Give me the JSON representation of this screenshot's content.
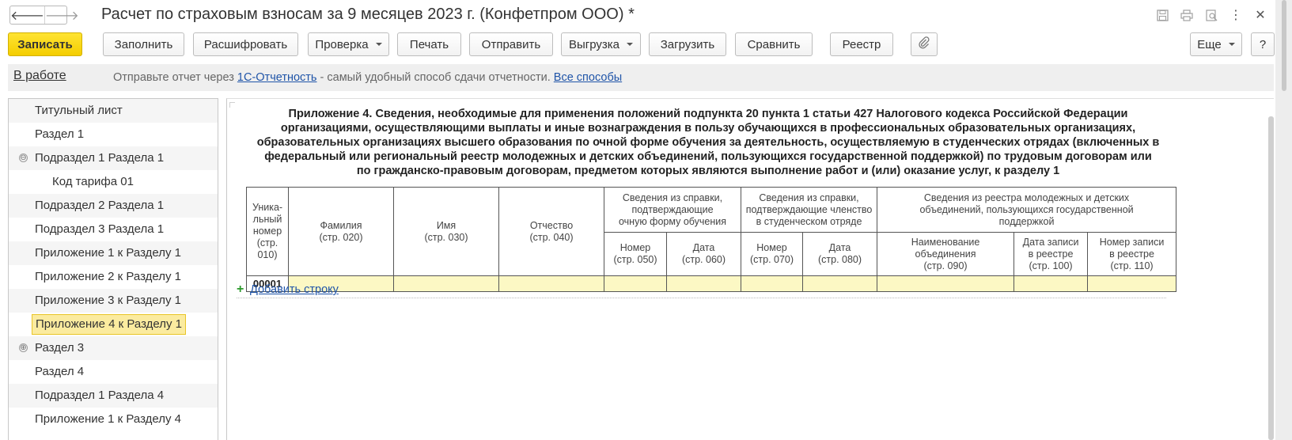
{
  "window": {
    "title": "Расчет по страховым взносам за 9 месяцев 2023 г. (Конфетпром ООО) *",
    "back_icon": "arrow-left-icon",
    "forward_icon": "arrow-right-icon",
    "icons": [
      "save-icon",
      "print-icon",
      "preview-icon",
      "more-vertical-icon",
      "close-icon"
    ]
  },
  "toolbar": {
    "save": "Записать",
    "fill": "Заполнить",
    "decode": "Расшифровать",
    "check": "Проверка",
    "print": "Печать",
    "send": "Отправить",
    "export": "Выгрузка",
    "load": "Загрузить",
    "compare": "Сравнить",
    "registry": "Реестр",
    "attach_icon": "paperclip-icon",
    "more": "Еще",
    "help": "?"
  },
  "infobar": {
    "status": "В работе",
    "text_before": "Отправьте отчет через ",
    "link1": "1С-Отчетность",
    "text_after": " - самый удобный способ сдачи отчетности. ",
    "link2": "Все способы"
  },
  "tree": {
    "items": [
      {
        "label": "Титульный лист"
      },
      {
        "label": "Раздел 1"
      },
      {
        "label": "Подраздел 1 Раздела 1",
        "toggle": "⊖"
      },
      {
        "label": "Код тарифа 01"
      },
      {
        "label": "Подраздел 2 Раздела 1"
      },
      {
        "label": "Подраздел 3 Раздела 1"
      },
      {
        "label": "Приложение 1 к Разделу 1"
      },
      {
        "label": "Приложение 2 к Разделу 1"
      },
      {
        "label": "Приложение 3 к Разделу 1"
      },
      {
        "label": "Приложение 4 к Разделу 1",
        "selected": true
      },
      {
        "label": "Раздел 3",
        "toggle": "⊕"
      },
      {
        "label": "Раздел 4"
      },
      {
        "label": "Подраздел 1 Раздела 4"
      },
      {
        "label": "Приложение 1 к Разделу 4"
      }
    ]
  },
  "form": {
    "heading": [
      "Приложение 4. Сведения, необходимые для применения положений подпункта 20 пункта 1 статьи 427 Налогового кодекса Российской Федерации",
      "организациями, осуществляющими выплаты и иные вознаграждения в пользу обучающихся в профессиональных образовательных организациях,",
      "образовательных организациях высшего образования по очной форме обучения за деятельность, осуществляемую в студенческих отрядах (включенных в",
      "федеральный или региональный реестр молодежных и детских объединений, пользующихся государственной поддержкой) по трудовым договорам или",
      "по гражданско-правовым договорам, предметом которых являются выполнение работ и (или) оказание услуг, к разделу 1"
    ],
    "table": {
      "col_uid": [
        "Уника-",
        "льный",
        "номер",
        "(стр.",
        "010)"
      ],
      "col_surname": [
        "Фамилия",
        "(стр. 020)"
      ],
      "col_name": [
        "Имя",
        "(стр. 030)"
      ],
      "col_patronymic": [
        "Отчество",
        "(стр. 040)"
      ],
      "group_study": [
        "Сведения из справки,",
        "подтверждающие",
        "очную форму обучения"
      ],
      "group_squad": [
        "Сведения из справки,",
        "подтверждающие членство",
        "в студенческом отряде"
      ],
      "group_registry": [
        "Сведения из реестра молодежных и детских",
        "объединений, пользующихся государственной",
        "поддержкой"
      ],
      "col_050": [
        "Номер",
        "(стр. 050)"
      ],
      "col_060": [
        "Дата",
        "(стр. 060)"
      ],
      "col_070": [
        "Номер",
        "(стр. 070)"
      ],
      "col_080": [
        "Дата",
        "(стр. 080)"
      ],
      "col_090": [
        "Наименование",
        "объединения",
        "(стр. 090)"
      ],
      "col_100": [
        "Дата записи",
        "в реестре",
        "(стр. 100)"
      ],
      "col_110": [
        "Номер записи",
        "в реестре",
        "(стр. 110)"
      ],
      "rows": [
        {
          "uid": "00001",
          "cells": [
            "",
            "",
            "",
            "",
            "",
            "",
            "",
            "",
            "",
            ""
          ]
        }
      ]
    },
    "add_row_plus": "+",
    "add_row": "Добавить строку"
  }
}
